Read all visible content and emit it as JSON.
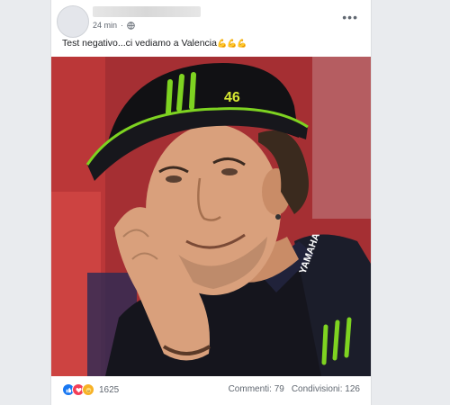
{
  "post": {
    "timestamp": "24 min",
    "privacy_icon": "globe-icon",
    "text": "Test negativo...ci vediamo a Valencia",
    "text_emojis": "💪💪💪",
    "more_label": "•••"
  },
  "photo": {
    "cap_number": "46",
    "cap_brand_icon": "monster-logo-icon",
    "shirt_text": "YAMAHA"
  },
  "footer": {
    "reaction_icons": [
      "like-icon",
      "love-icon",
      "care-icon"
    ],
    "reaction_count": "1625",
    "comments": "Commenti: 79",
    "shares": "Condivisioni: 126"
  },
  "colors": {
    "brand_blue": "#1877f2",
    "love": "#f33e58",
    "care": "#f7b125",
    "monster_green": "#7ed321",
    "background": "#e9ebee"
  }
}
